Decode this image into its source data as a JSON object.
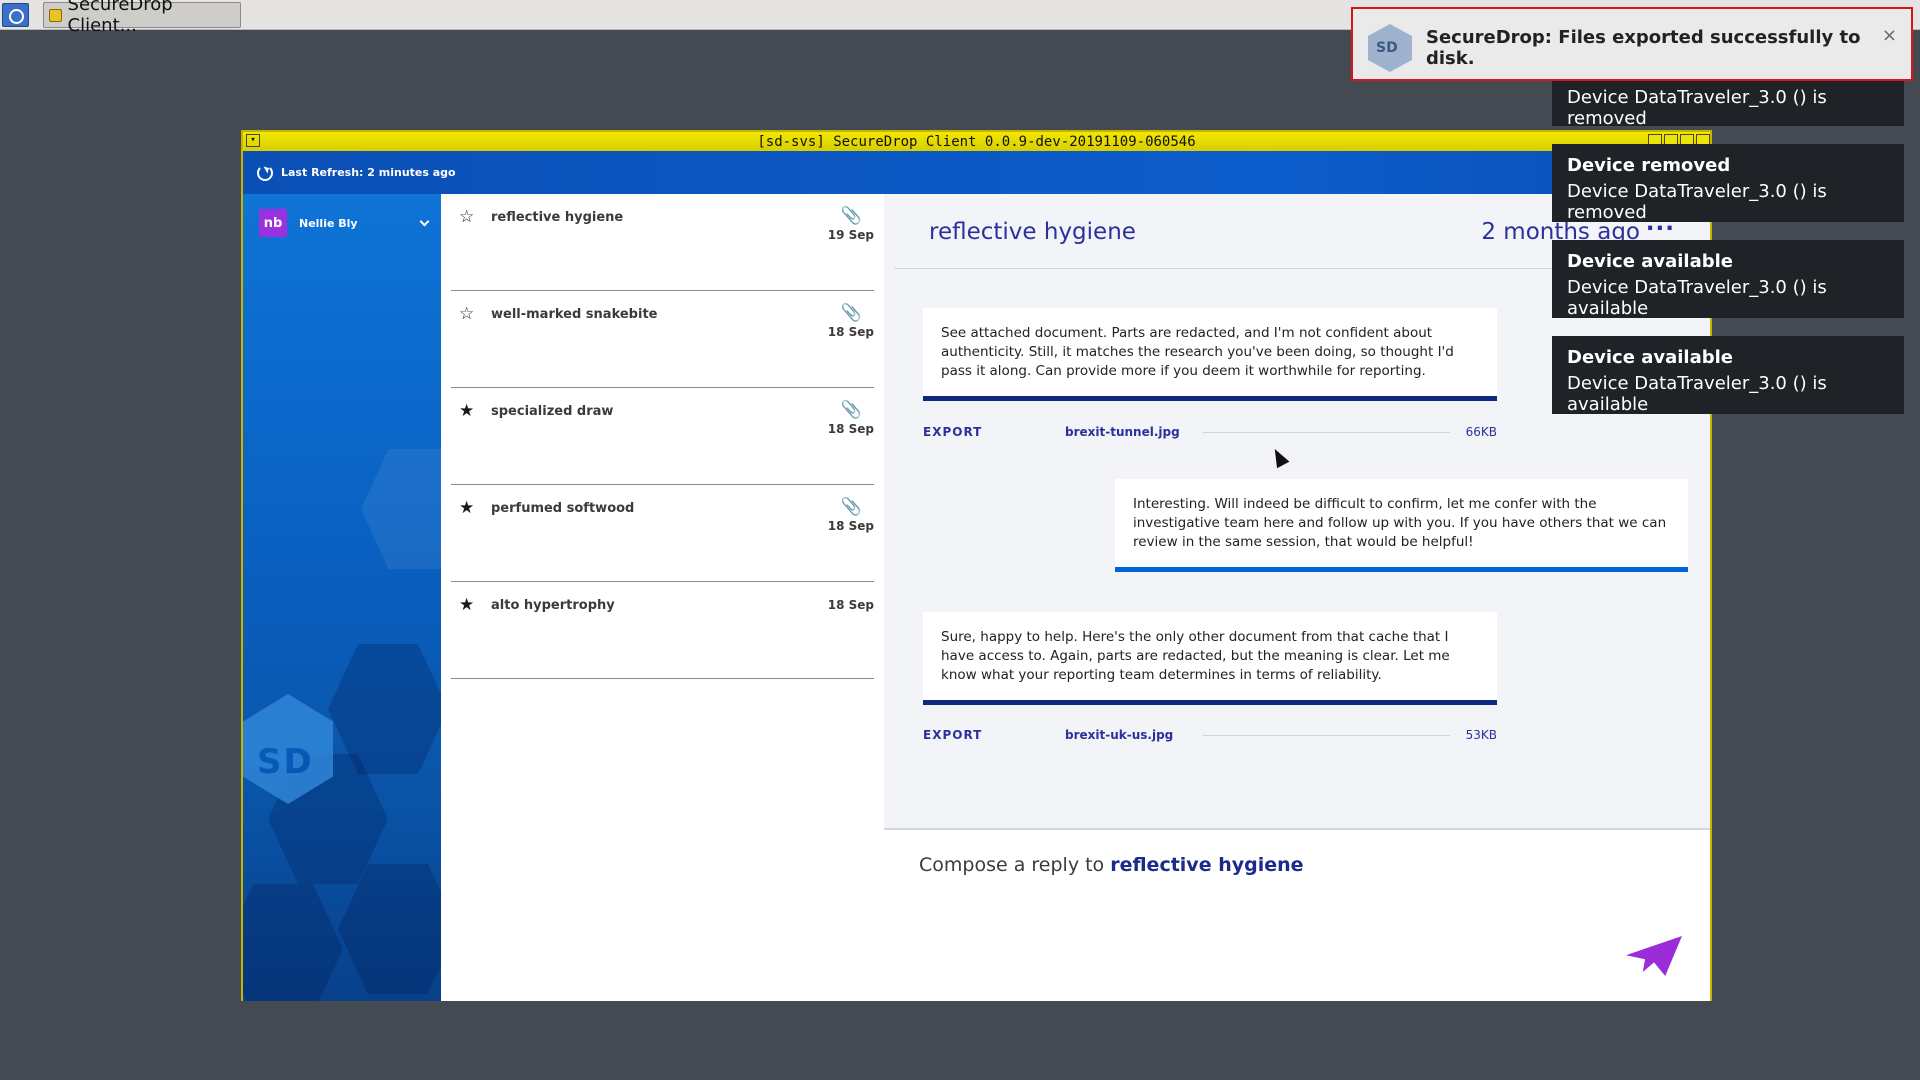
{
  "taskbar": {
    "task_label": "SecureDrop Client..."
  },
  "window": {
    "title": "[sd-svs] SecureDrop Client 0.0.9-dev-20191109-060546",
    "last_refresh": "Last Refresh: 2 minutes ago"
  },
  "user": {
    "initials": "nb",
    "name": "Nellie Bly"
  },
  "sources": [
    {
      "name": "reflective hygiene",
      "date": "19 Sep",
      "starred": false,
      "attachment": true
    },
    {
      "name": "well-marked snakebite",
      "date": "18 Sep",
      "starred": false,
      "attachment": true
    },
    {
      "name": "specialized draw",
      "date": "18 Sep",
      "starred": true,
      "attachment": true
    },
    {
      "name": "perfumed softwood",
      "date": "18 Sep",
      "starred": true,
      "attachment": true
    },
    {
      "name": "alto hypertrophy",
      "date": "18 Sep",
      "starred": true,
      "attachment": false
    }
  ],
  "conversation": {
    "title": "reflective hygiene",
    "age": "2 months ago",
    "menu": "···",
    "messages": [
      {
        "kind": "source",
        "text": "See attached document. Parts are redacted, and I'm not confident about authenticity. Still, it matches the research you've been doing, so thought I'd pass it along. Can provide more if you deem it worthwhile for reporting."
      },
      {
        "kind": "reply",
        "text": "Interesting. Will indeed be difficult to confirm, let me confer with the investigative team here and follow up with you. If you have others that we can review in the same session, that would be helpful!"
      },
      {
        "kind": "source",
        "text": "Sure, happy to help. Here's the only other document from that cache that I have access to. Again, parts are redacted, but the meaning is clear. Let me know what your reporting team determines in terms of reliability."
      }
    ],
    "files": [
      {
        "export_label": "EXPORT",
        "filename": "brexit-tunnel.jpg",
        "size": "66KB"
      },
      {
        "export_label": "EXPORT",
        "filename": "brexit-uk-us.jpg",
        "size": "53KB"
      }
    ]
  },
  "compose": {
    "prefix": "Compose a reply to ",
    "source_name": "reflective hygiene"
  },
  "notifications": {
    "top": {
      "text": "SecureDrop: Files exported successfully to disk.",
      "close": "×"
    },
    "toasts": [
      {
        "title": "",
        "body": "Device DataTraveler_3.0 () is removed"
      },
      {
        "title": "Device removed",
        "body": "Device DataTraveler_3.0 () is removed"
      },
      {
        "title": "Device available",
        "body": "Device DataTraveler_3.0 () is available"
      },
      {
        "title": "Device available",
        "body": "Device DataTraveler_3.0 () is available"
      }
    ]
  },
  "colors": {
    "accent": "#2a319d",
    "source_bar": "#102781",
    "reply_bar": "#0065db",
    "avatar": "#9b30e0",
    "send": "#9b2cd8",
    "titlebar": "#f2e800"
  }
}
